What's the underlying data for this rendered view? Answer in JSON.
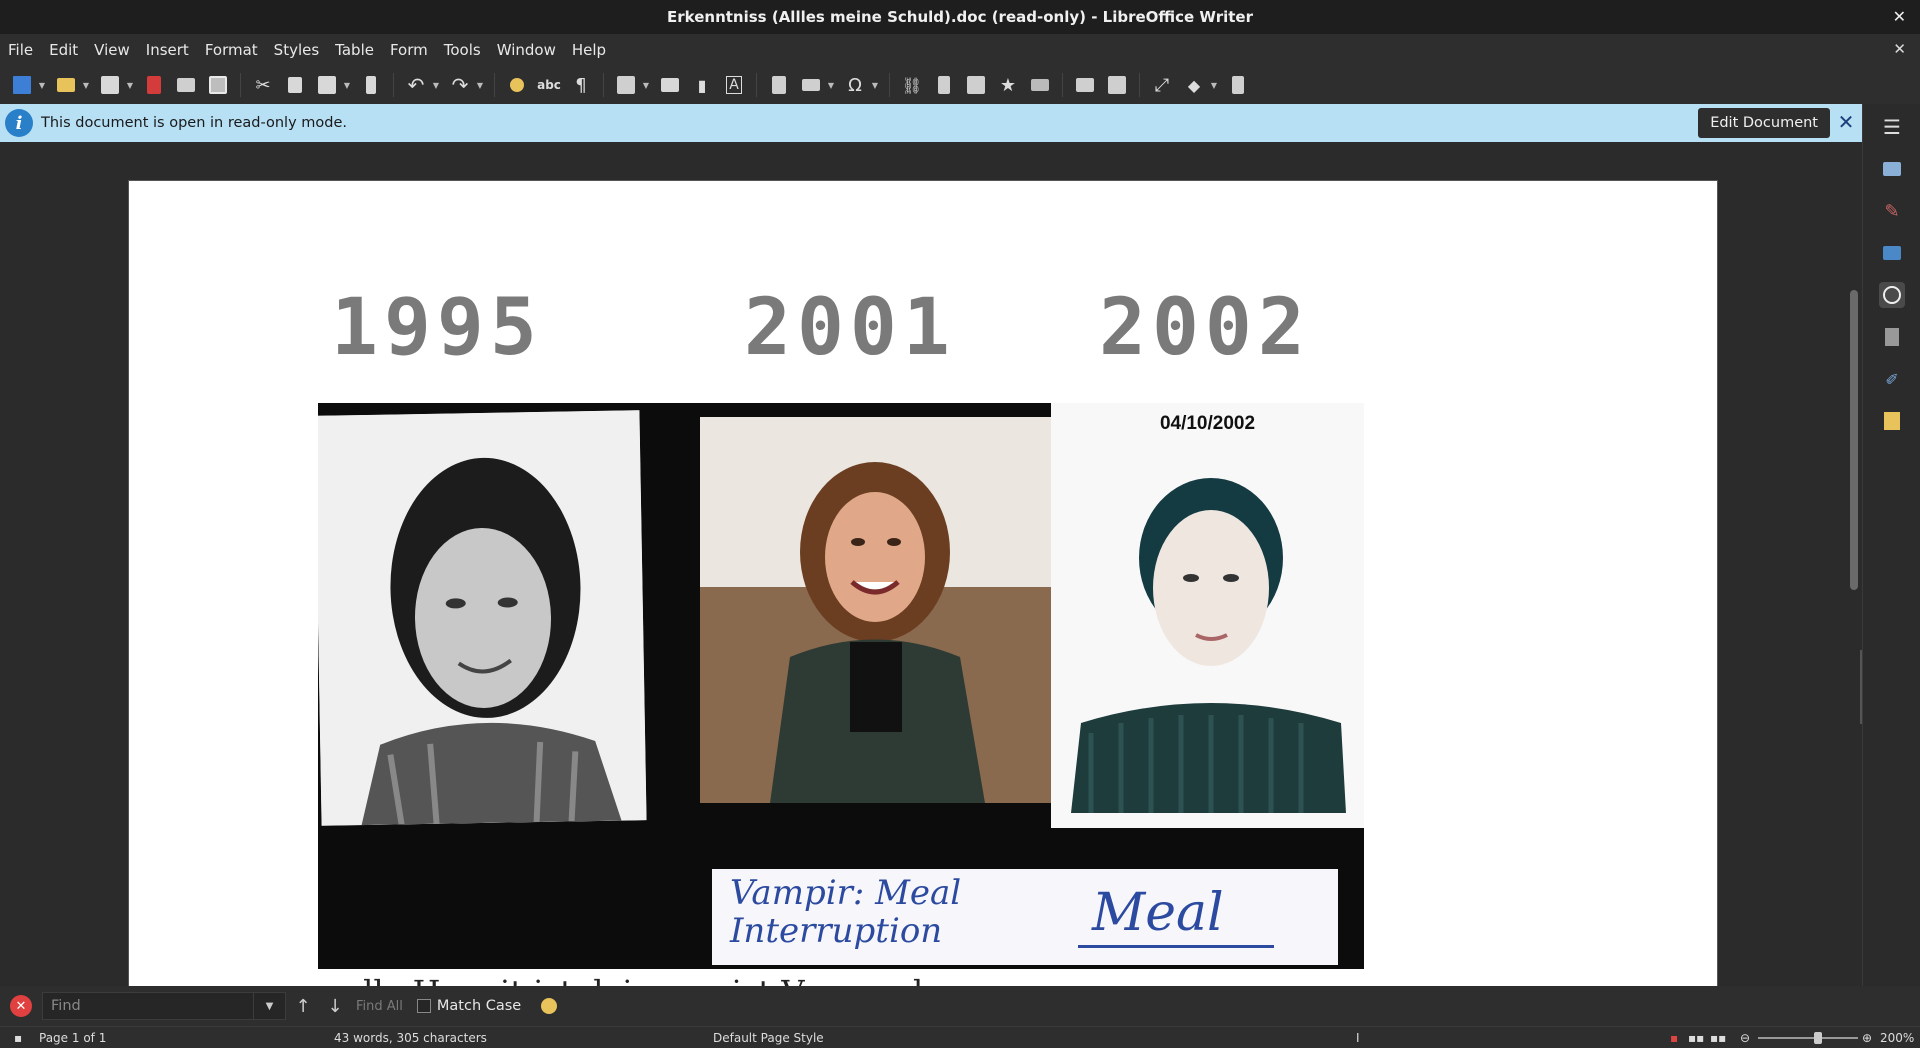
{
  "window": {
    "title": "Erkenntniss (Allles meine Schuld).doc (read-only) - LibreOffice Writer"
  },
  "menubar": {
    "items": [
      "File",
      "Edit",
      "View",
      "Insert",
      "Format",
      "Styles",
      "Table",
      "Form",
      "Tools",
      "Window",
      "Help"
    ]
  },
  "toolbar": {
    "icons": [
      "new-document-icon",
      "open-icon",
      "save-icon",
      "export-pdf-icon",
      "print-icon",
      "print-preview-icon",
      "cut-icon",
      "copy-icon",
      "paste-icon",
      "clone-formatting-icon",
      "undo-icon",
      "redo-icon",
      "find-replace-icon",
      "spelling-icon",
      "formatting-marks-icon",
      "insert-table-icon",
      "insert-image-icon",
      "insert-chart-icon",
      "insert-textbox-icon",
      "insert-page-break-icon",
      "insert-field-icon",
      "special-character-icon",
      "hyperlink-icon",
      "footnote-icon",
      "comment-icon",
      "bookmark-icon",
      "cross-reference-icon",
      "track-changes-icon",
      "show-changes-icon",
      "line-icon",
      "basic-shapes-icon",
      "draw-functions-icon"
    ]
  },
  "infobar": {
    "message": "This document is open in read-only mode.",
    "edit_button": "Edit Document"
  },
  "document": {
    "years": [
      "1995",
      "2001",
      "2002"
    ],
    "photo_date": "04/10/2002",
    "note_left_line1": "Vampir: Meal",
    "note_left_line2": "Interruption",
    "note_right": "Meal",
    "partial_text": "alle Hem it ist deine meist Verwand"
  },
  "findbar": {
    "placeholder": "Find",
    "find_all": "Find All",
    "match_case": "Match Case"
  },
  "statusbar": {
    "page": "Page 1 of 1",
    "word_count": "43 words, 305 characters",
    "page_style": "Default Page Style",
    "zoom": "200%"
  },
  "colors": {
    "infobar_bg": "#b8e0f5",
    "accent_blue": "#2a7fc9",
    "year_gray": "#7a7a7a"
  }
}
